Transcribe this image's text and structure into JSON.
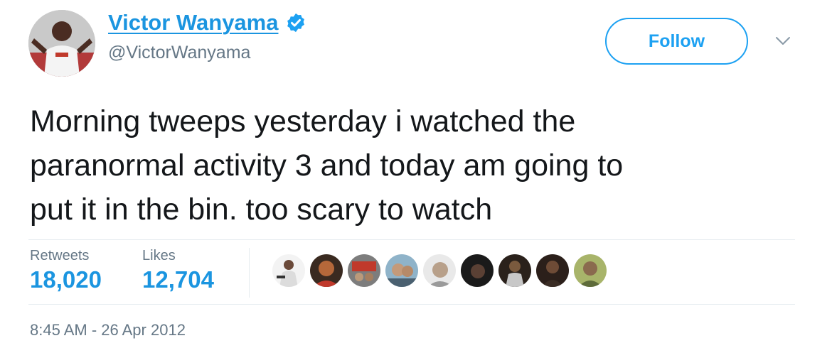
{
  "author": {
    "display_name": "Victor Wanyama",
    "handle": "@VictorWanyama",
    "verified": true,
    "avatar_icon": "profile-photo"
  },
  "actions": {
    "follow_label": "Follow",
    "menu_icon": "chevron-down-icon"
  },
  "tweet": {
    "text": "Morning tweeps yesterday i watched the\nparanormal activity 3 and today am going to\nput it in the bin. too scary to watch"
  },
  "stats": {
    "retweets_label": "Retweets",
    "retweets_value": "18,020",
    "likes_label": "Likes",
    "likes_value": "12,704"
  },
  "likers": [
    {
      "icon": "liker-avatar-1",
      "color": "#f3f3f3"
    },
    {
      "icon": "liker-avatar-2",
      "color": "#b5683a"
    },
    {
      "icon": "liker-avatar-3",
      "color": "#c0392b"
    },
    {
      "icon": "liker-avatar-4",
      "color": "#8fb3c9"
    },
    {
      "icon": "liker-avatar-5",
      "color": "#cfcfcf"
    },
    {
      "icon": "liker-avatar-6",
      "color": "#1a1a1a"
    },
    {
      "icon": "liker-avatar-7",
      "color": "#7a5a3e"
    },
    {
      "icon": "liker-avatar-8",
      "color": "#2b1f1a"
    },
    {
      "icon": "liker-avatar-9",
      "color": "#a8b46a"
    }
  ],
  "timestamp": "8:45 AM - 26 Apr 2012",
  "colors": {
    "accent": "#1da1f2",
    "link": "#1b95e0",
    "muted": "#657786",
    "text": "#14171a",
    "divider": "#e6ecf0"
  }
}
